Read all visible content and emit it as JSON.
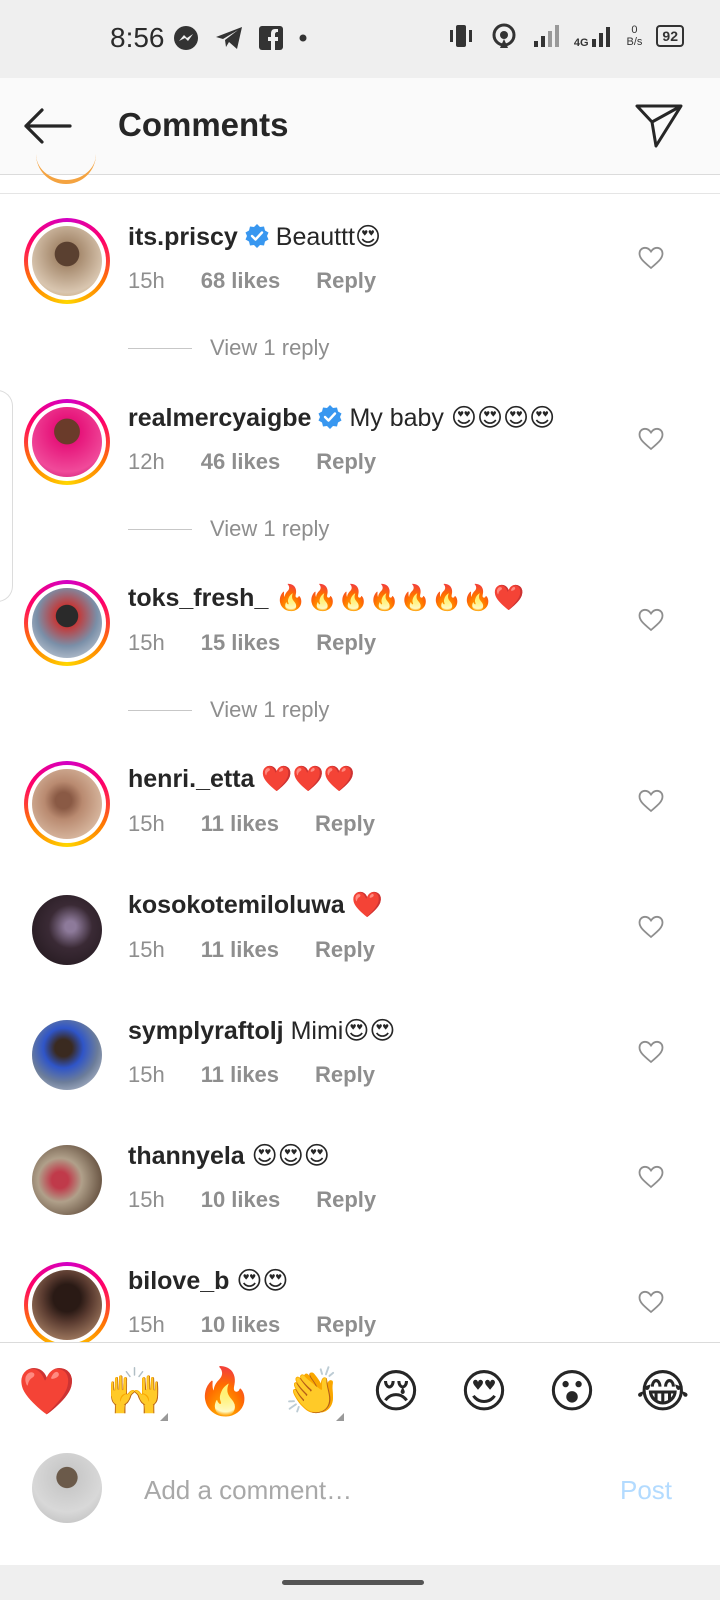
{
  "status_bar": {
    "time": "8:56",
    "network": "4G",
    "speed_value": "0",
    "speed_unit": "B/s",
    "battery": "92"
  },
  "header": {
    "title": "Comments"
  },
  "comments": [
    {
      "user": "its.priscy",
      "verified": true,
      "text": "Beauttt😍",
      "time": "15h",
      "likes": "68 likes",
      "reply": "Reply",
      "view_replies": "View 1 reply",
      "avatar_color": "#a78b6f"
    },
    {
      "user": "realmercyaigbe",
      "verified": true,
      "text": "My baby 😍😍😍😍",
      "time": "12h",
      "likes": "46 likes",
      "reply": "Reply",
      "view_replies": "View 1 reply",
      "avatar_color": "#e6147a"
    },
    {
      "user": "toks_fresh_",
      "verified": false,
      "text": "🔥🔥🔥🔥🔥🔥🔥❤️",
      "time": "15h",
      "likes": "15 likes",
      "reply": "Reply",
      "view_replies": "View 1 reply",
      "avatar_color": "#7a8fa8"
    },
    {
      "user": "henri._etta",
      "verified": false,
      "text": "❤️❤️❤️",
      "time": "15h",
      "likes": "11 likes",
      "reply": "Reply",
      "avatar_color": "#b98a70"
    },
    {
      "user": "kosokotemiloluwa",
      "verified": false,
      "text": "❤️",
      "time": "15h",
      "likes": "11 likes",
      "reply": "Reply",
      "avatar_color": "#3a2a35"
    },
    {
      "user": "symplyraftolj",
      "verified": false,
      "text": "Mimi😍😍",
      "time": "15h",
      "likes": "11 likes",
      "reply": "Reply",
      "avatar_color": "#6c7d9a"
    },
    {
      "user": "thannyela",
      "verified": false,
      "text": "😍😍😍",
      "time": "15h",
      "likes": "10 likes",
      "reply": "Reply",
      "avatar_color": "#b0a08a"
    },
    {
      "user": "bilove_b",
      "verified": false,
      "text": "😍😍",
      "time": "15h",
      "likes": "10 likes",
      "reply": "Reply",
      "avatar_color": "#5a3b30"
    }
  ],
  "emoji_bar": [
    "❤️",
    "🙌",
    "🔥",
    "👏",
    "😢",
    "😍",
    "😮",
    "😂"
  ],
  "composer": {
    "placeholder": "Add a comment…",
    "post_label": "Post"
  },
  "colors": {
    "accent_blue": "#3897f0",
    "post_disabled": "#b3dbff",
    "meta_gray": "#8e8e8e"
  }
}
